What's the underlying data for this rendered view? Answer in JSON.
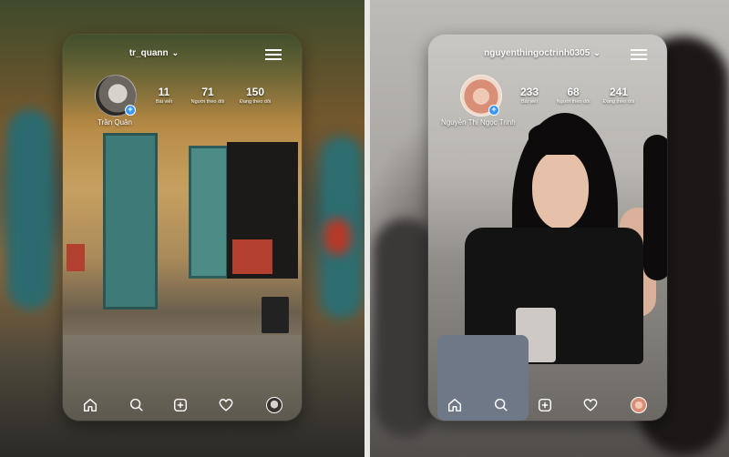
{
  "left_profile": {
    "username": "tr_quann",
    "display_name": "Trần Quân",
    "stats": [
      {
        "count": "11",
        "label": "Bài viết"
      },
      {
        "count": "71",
        "label": "Người theo dõi"
      },
      {
        "count": "150",
        "label": "Đang theo dõi"
      }
    ]
  },
  "right_profile": {
    "username": "nguyenthingoctrinh0305",
    "display_name": "Nguyễn Thị Ngọc Trinh",
    "stats": [
      {
        "count": "233",
        "label": "Bài viết"
      },
      {
        "count": "68",
        "label": "Người theo dõi"
      },
      {
        "count": "241",
        "label": "Đang theo dõi"
      }
    ]
  },
  "icons": {
    "dropdown": "chevron-down-icon",
    "menu": "hamburger-menu-icon",
    "add_story": "plus-icon",
    "nav": [
      "home-icon",
      "search-icon",
      "add-post-icon",
      "heart-icon",
      "profile-icon"
    ]
  },
  "colors": {
    "accent_blue": "#3897f0",
    "text": "#ffffff"
  }
}
